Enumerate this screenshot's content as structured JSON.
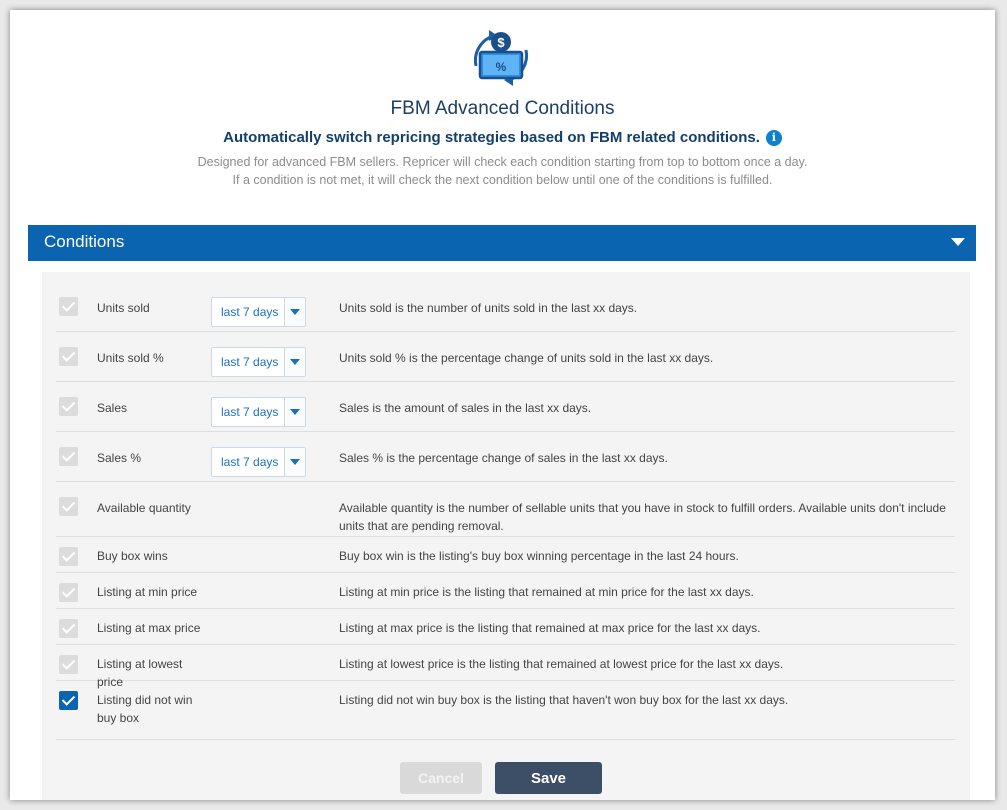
{
  "header": {
    "logo_icon": "repricing-cycle-icon",
    "title": "FBM Advanced Conditions",
    "subtitle": "Automatically switch repricing strategies based on FBM related conditions.",
    "info_icon": "i",
    "description_line1": "Designed for advanced FBM sellers. Repricer will check each condition starting from top to bottom once a day.",
    "description_line2": "If a condition is not met, it will check the next condition below until one of the conditions is fulfilled."
  },
  "section": {
    "title": "Conditions",
    "accent_color": "#0a64b0"
  },
  "conditions": [
    {
      "label": "Units sold",
      "period": "last 7 days",
      "checked": true,
      "enabled": false,
      "description": "Units sold is the number of units sold in the last xx days."
    },
    {
      "label": "Units sold %",
      "period": "last 7 days",
      "checked": true,
      "enabled": false,
      "description": "Units sold % is the percentage change of units sold in the last xx days."
    },
    {
      "label": "Sales",
      "period": "last 7 days",
      "checked": true,
      "enabled": false,
      "description": "Sales is the amount of sales in the last xx days."
    },
    {
      "label": "Sales %",
      "period": "last 7 days",
      "checked": true,
      "enabled": false,
      "description": "Sales % is the percentage change of sales in the last xx days."
    },
    {
      "label": "Available quantity",
      "checked": true,
      "enabled": false,
      "description": "Available quantity is the number of sellable units that you have in stock to fulfill orders. Available units don't include units that are pending removal."
    },
    {
      "label": "Buy box wins",
      "checked": true,
      "enabled": false,
      "description": "Buy box win is the listing's buy box winning percentage in the last 24 hours."
    },
    {
      "label": "Listing at min price",
      "checked": true,
      "enabled": false,
      "description": "Listing at min price is the listing that remained at min price for the last xx days."
    },
    {
      "label": "Listing at max price",
      "checked": true,
      "enabled": false,
      "description": "Listing at max price is the listing that remained at max price for the last xx days."
    },
    {
      "label": "Listing at lowest price",
      "checked": true,
      "enabled": false,
      "description": "Listing at lowest price is the listing that remained at lowest price for the last xx days."
    },
    {
      "label": "Listing did not win buy box",
      "checked": true,
      "enabled": true,
      "description": "Listing did not win buy box is the listing that haven't won buy box for the last xx days."
    }
  ],
  "actions": {
    "cancel_label": "Cancel",
    "save_label": "Save"
  }
}
